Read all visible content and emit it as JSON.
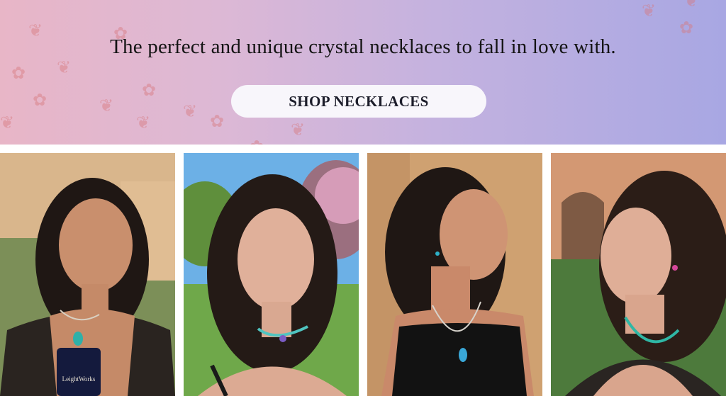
{
  "banner": {
    "headline": "The perfect and unique crystal necklaces to fall in love with.",
    "cta_label": "SHOP NECKLACES",
    "gradient_colors": [
      "#e8b6c7",
      "#c4b2df",
      "#a8a7e3"
    ],
    "leaf_color": "#d6787d"
  },
  "gallery": {
    "photos": [
      {
        "name": "model-photo-1",
        "pouch_text": "LeightWorks"
      },
      {
        "name": "model-photo-2"
      },
      {
        "name": "model-photo-3"
      },
      {
        "name": "model-photo-4"
      }
    ]
  }
}
